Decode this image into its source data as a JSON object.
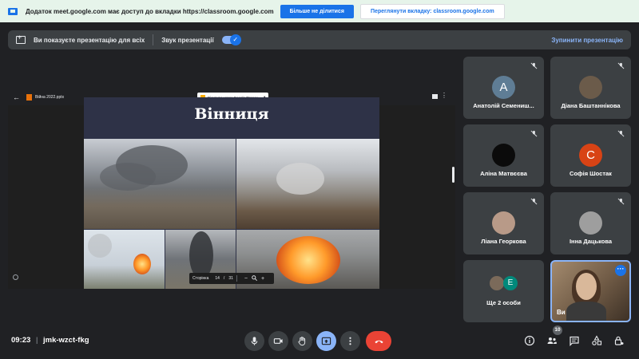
{
  "banner": {
    "text": "Додаток meet.google.com має доступ до вкладки https://classroom.google.com",
    "stop_label": "Більше не ділитися",
    "switch_label": "Переглянути вкладку: classroom.google.com"
  },
  "present_bar": {
    "text": "Ви показуєте презентацію для всіх",
    "sound_label": "Звук презентації",
    "stop_label": "Зупинити презентацію"
  },
  "shared": {
    "file_name": "Війна 2022.pptx",
    "open_with": "Відкрити через Google Презен...",
    "slide_title": "Вінниця",
    "pager_label": "Сторінка",
    "page_current": "14",
    "page_sep": "/",
    "page_total": "31",
    "zoom_out": "−",
    "zoom_in": "+"
  },
  "participants": [
    {
      "name": "Анатолій Семениш...",
      "initial": "А",
      "color": "#5f7d95"
    },
    {
      "name": "Діана Баштаннікова",
      "initial": "",
      "color": "#6b5b4a"
    },
    {
      "name": "Аліна Матвєєва",
      "initial": "",
      "color": "#0b0b0b"
    },
    {
      "name": "Софія Шостак",
      "initial": "С",
      "color": "#d84315"
    },
    {
      "name": "Ліана Георкова",
      "initial": "",
      "color": "#b89a88"
    },
    {
      "name": "Інна Дацькова",
      "initial": "",
      "color": "#9e9e9e"
    }
  ],
  "others": {
    "label": "Ще 2 особи",
    "initial": "Е",
    "color": "#00897b"
  },
  "self": {
    "name": "Ви"
  },
  "bottom": {
    "time": "09:23",
    "separator": "|",
    "meeting_code": "jmk-wzct-fkg",
    "participant_count": "10"
  }
}
